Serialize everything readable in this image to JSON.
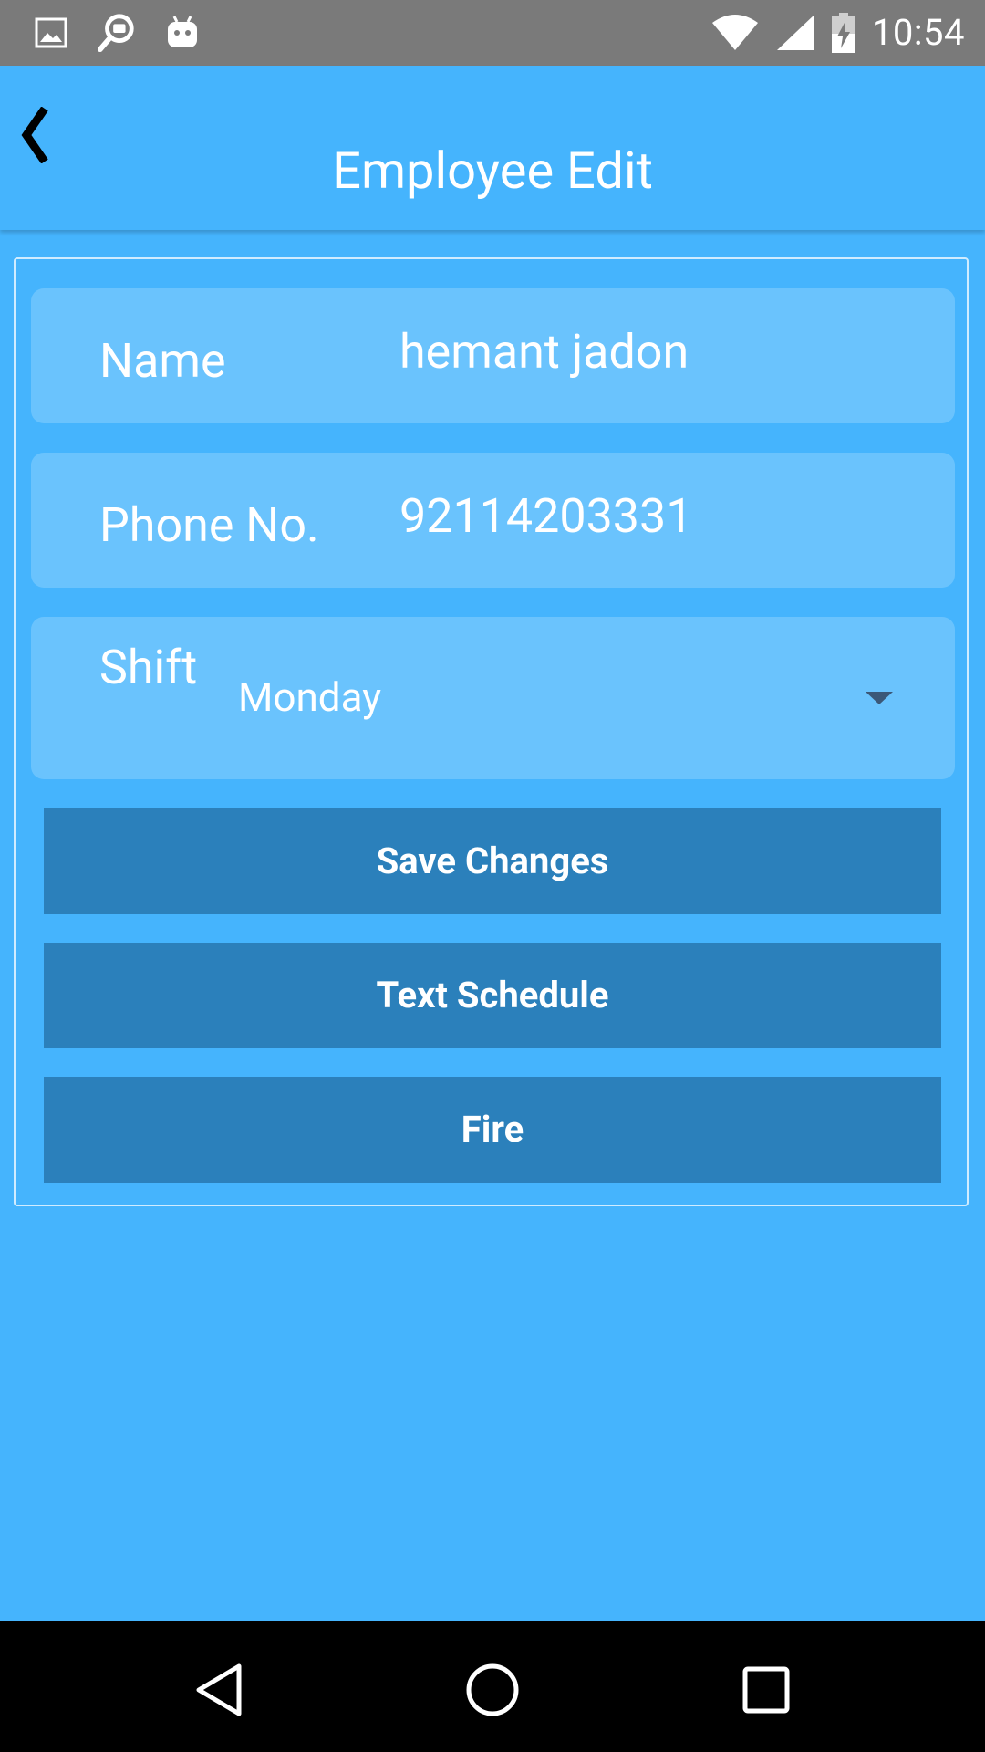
{
  "status_bar": {
    "time": "10:54",
    "icons_left": [
      "gallery-icon",
      "search-notification-icon",
      "android-icon"
    ],
    "icons_right": [
      "wifi-icon",
      "cell-signal-icon",
      "battery-charging-icon"
    ]
  },
  "header": {
    "title": "Employee Edit",
    "back_icon": "chevron-left-icon"
  },
  "form": {
    "name_label": "Name",
    "name_value": "hemant jadon",
    "phone_label": "Phone No.",
    "phone_value": "92114203331",
    "shift_label": "Shift",
    "shift_value": "Monday"
  },
  "buttons": {
    "save": "Save Changes",
    "text_schedule": "Text Schedule",
    "fire": "Fire"
  },
  "nav_bar": {
    "icons": [
      "back-triangle-icon",
      "home-circle-icon",
      "recents-square-icon"
    ]
  },
  "colors": {
    "background": "#45b4fd",
    "field": "#6ac3fd",
    "button": "#2b80bb",
    "status_bar": "#7a7a7a"
  }
}
